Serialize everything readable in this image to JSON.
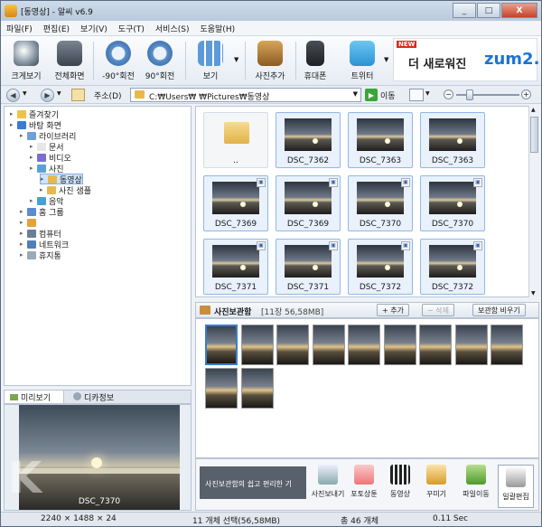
{
  "window": {
    "title": "[동영상] - 알씨 v6.9",
    "min": "_",
    "max": "□",
    "close": "X"
  },
  "menu": [
    "파일(F)",
    "편집(E)",
    "보기(V)",
    "도구(T)",
    "서비스(S)",
    "도움말(H)"
  ],
  "toolbar": {
    "fullsize": "크게보기",
    "fullscreen": "전체화면",
    "rotate_left": "-90°회전",
    "rotate_right": "90°회전",
    "view": "보기",
    "add_photo": "사진추가",
    "phone": "휴대폰",
    "twitter": "트위터"
  },
  "ad": {
    "badge": "NEW",
    "text": "더 새로워진",
    "brand": "zum2."
  },
  "address": {
    "label": "주소(D)",
    "path": "C:₩Users₩    ₩Pictures₩동영상",
    "go": "이동",
    "zoom_minus": "−",
    "zoom_plus": "+",
    "zoom_level": 0.15
  },
  "tree": [
    {
      "label": "즐겨찾기",
      "level": 0
    },
    {
      "label": "바탕 화면",
      "level": 0
    },
    {
      "label": "라이브러리",
      "level": 1
    },
    {
      "label": "문서",
      "level": 2
    },
    {
      "label": "비디오",
      "level": 2
    },
    {
      "label": "사진",
      "level": 2
    },
    {
      "label": "동영상",
      "level": 3,
      "selected": true
    },
    {
      "label": "사진 샘플",
      "level": 3
    },
    {
      "label": "음악",
      "level": 2
    },
    {
      "label": "홈 그룹",
      "level": 1
    },
    {
      "label": "",
      "level": 1
    },
    {
      "label": "컴퓨터",
      "level": 1
    },
    {
      "label": "네트워크",
      "level": 1
    },
    {
      "label": "휴지통",
      "level": 1
    }
  ],
  "preview_tabs": [
    "미리보기",
    "디카정보"
  ],
  "preview": {
    "caption": "DSC_7370",
    "watermark": "K"
  },
  "files": [
    {
      "name": "..",
      "type": "folder"
    },
    {
      "name": "DSC_7362",
      "type": "image"
    },
    {
      "name": "DSC_7363",
      "type": "image"
    },
    {
      "name": "DSC_7363",
      "type": "image"
    },
    {
      "name": "DSC_7369",
      "type": "image",
      "badge": true
    },
    {
      "name": "DSC_7369",
      "type": "image",
      "badge": true
    },
    {
      "name": "DSC_7370",
      "type": "image",
      "badge": true
    },
    {
      "name": "DSC_7370",
      "type": "image",
      "badge": true
    },
    {
      "name": "DSC_7371",
      "type": "image",
      "badge": true
    },
    {
      "name": "DSC_7371",
      "type": "image",
      "badge": true
    },
    {
      "name": "DSC_7372",
      "type": "image",
      "badge": true
    },
    {
      "name": "DSC_7372",
      "type": "image",
      "badge": true
    }
  ],
  "photobox": {
    "title": "사진보관함",
    "count": "[11장 56,58MB]",
    "add": "+ 추가",
    "remove": "− 삭제",
    "empty": "보관함 비우기"
  },
  "photobox_count": 11,
  "bottom": {
    "promo": "사진보관함의 쉽고 편리한 기",
    "buttons": [
      "사진보내기",
      "포토상툰",
      "동영상",
      "꾸미기",
      "파일이동",
      "일괄편집"
    ]
  },
  "status": {
    "dims": "2240 × 1488 × 24",
    "selected": "11 개체 선택(56,58MB)",
    "total": "총 46 개체",
    "time": "0.11 Sec"
  }
}
